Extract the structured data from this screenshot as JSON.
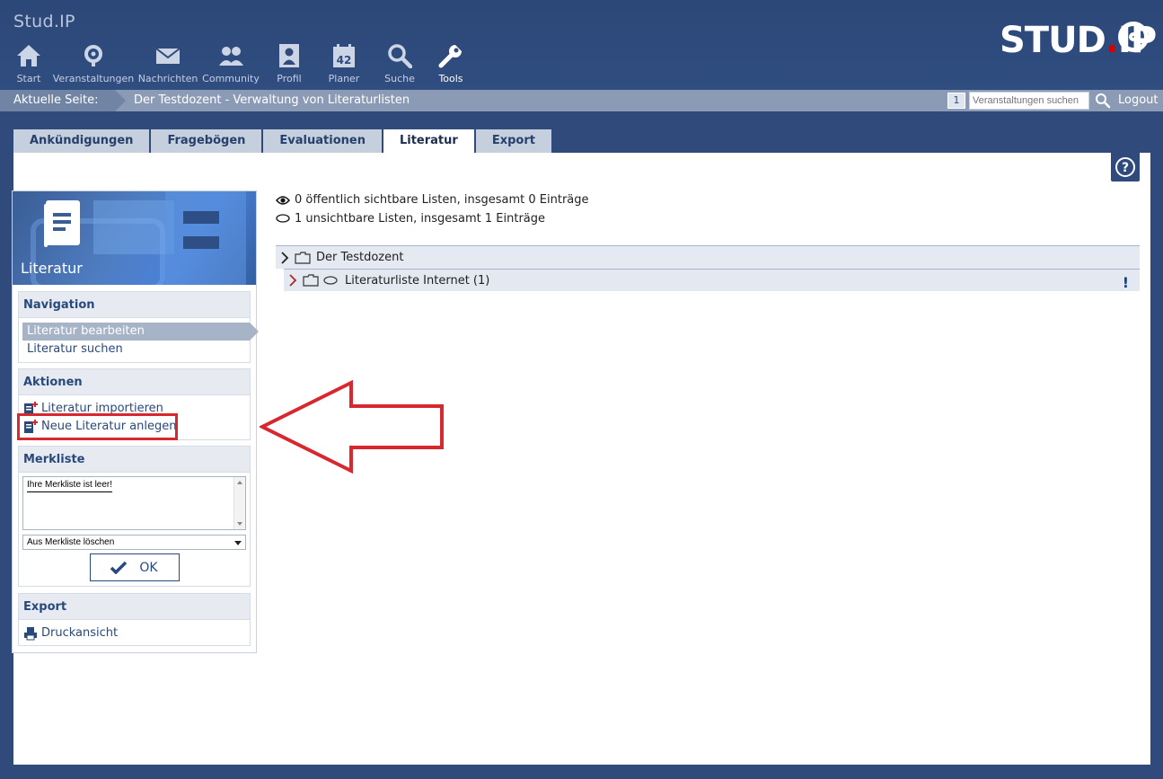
{
  "app": {
    "title": "Stud.IP",
    "logo_text": "STUD",
    "logo_dot": ".",
    "logo_ip": "IP"
  },
  "nav": [
    {
      "label": "Start",
      "icon": "home-icon"
    },
    {
      "label": "Veranstaltungen",
      "icon": "seminar-icon"
    },
    {
      "label": "Nachrichten",
      "icon": "mail-icon"
    },
    {
      "label": "Community",
      "icon": "community-icon"
    },
    {
      "label": "Profil",
      "icon": "profile-icon"
    },
    {
      "label": "Planer",
      "icon": "calendar-icon",
      "badge": "42"
    },
    {
      "label": "Suche",
      "icon": "search-icon"
    },
    {
      "label": "Tools",
      "icon": "tools-icon",
      "active": true
    }
  ],
  "breadcrumb": {
    "label": "Aktuelle Seite:",
    "path": "Der Testdozent - Verwaltung von Literaturlisten",
    "count": "1",
    "search_placeholder": "Veranstaltungen suchen",
    "logout": "Logout"
  },
  "tabs": [
    {
      "label": "Ankündigungen"
    },
    {
      "label": "Fragebögen"
    },
    {
      "label": "Evaluationen"
    },
    {
      "label": "Literatur",
      "active": true
    },
    {
      "label": "Export"
    }
  ],
  "sidebar": {
    "title": "Literatur",
    "navigation": {
      "title": "Navigation",
      "items": [
        {
          "label": "Literatur bearbeiten",
          "active": true
        },
        {
          "label": "Literatur suchen"
        }
      ]
    },
    "actions": {
      "title": "Aktionen",
      "items": [
        {
          "label": "Literatur importieren"
        },
        {
          "label": "Neue Literatur anlegen"
        }
      ]
    },
    "merkliste": {
      "title": "Merkliste",
      "empty_text": "Ihre Merkliste ist leer!",
      "select_value": "Aus Merkliste löschen",
      "ok_label": "OK"
    },
    "export": {
      "title": "Export",
      "items": [
        {
          "label": "Druckansicht"
        }
      ]
    }
  },
  "content": {
    "public_stats": "0 öffentlich sichtbare Listen, insgesamt 0 Einträge",
    "hidden_stats": "1 unsichtbare Listen, insgesamt 1 Einträge",
    "tree": {
      "root": "Der Testdozent",
      "child": "Literaturliste Internet (1)",
      "child_marker": "!"
    }
  },
  "colors": {
    "header_bg": "#2f4a7b",
    "accent": "#28497c",
    "annotation": "#d7282f"
  }
}
